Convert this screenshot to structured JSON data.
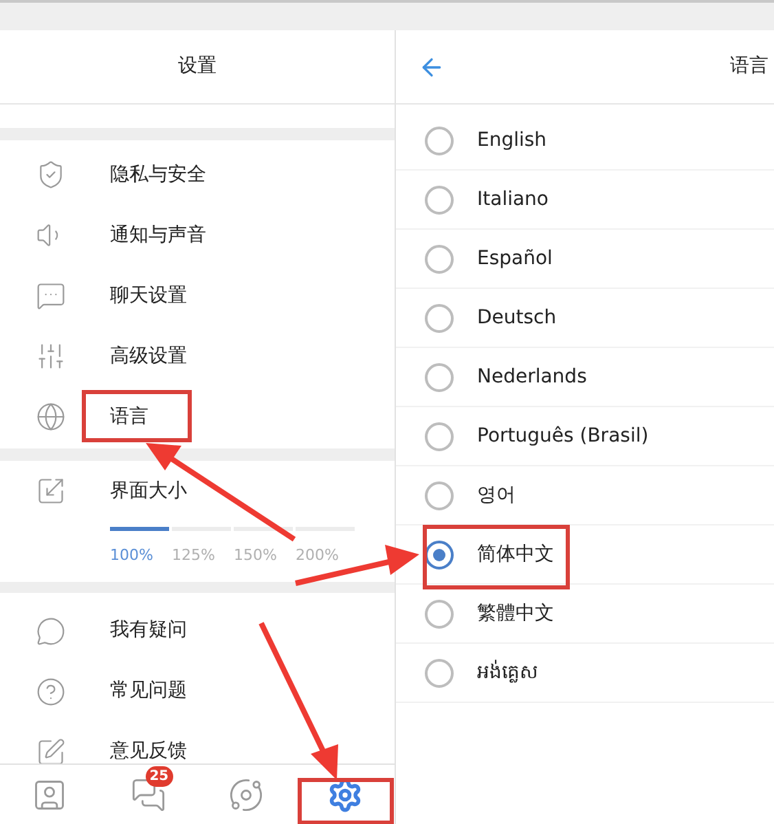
{
  "settings": {
    "title": "设置",
    "groups": [
      {
        "items": [
          {
            "label": "隐私与安全"
          },
          {
            "label": "通知与声音"
          },
          {
            "label": "聊天设置"
          },
          {
            "label": "高级设置"
          },
          {
            "label": "语言"
          }
        ]
      },
      {
        "items": [
          {
            "label": "我有疑问"
          },
          {
            "label": "常见问题"
          },
          {
            "label": "意见反馈"
          }
        ]
      }
    ],
    "interface_size": {
      "label": "界面大小",
      "options": [
        {
          "label": "100%",
          "selected": true
        },
        {
          "label": "125%",
          "selected": false
        },
        {
          "label": "150%",
          "selected": false
        },
        {
          "label": "200%",
          "selected": false
        }
      ]
    }
  },
  "bottom_nav": [
    {
      "selected": false
    },
    {
      "selected": false,
      "badge": "25"
    },
    {
      "selected": false
    },
    {
      "selected": true
    }
  ],
  "language": {
    "title": "语言",
    "options": [
      {
        "label": "English",
        "selected": false
      },
      {
        "label": "Italiano",
        "selected": false
      },
      {
        "label": "Español",
        "selected": false
      },
      {
        "label": "Deutsch",
        "selected": false
      },
      {
        "label": "Nederlands",
        "selected": false
      },
      {
        "label": "Português (Brasil)",
        "selected": false
      },
      {
        "label": "영어",
        "selected": false
      },
      {
        "label": "简体中文",
        "selected": true
      },
      {
        "label": "繁體中文",
        "selected": false
      },
      {
        "label": "អង់គ្លេស",
        "selected": false
      }
    ]
  }
}
